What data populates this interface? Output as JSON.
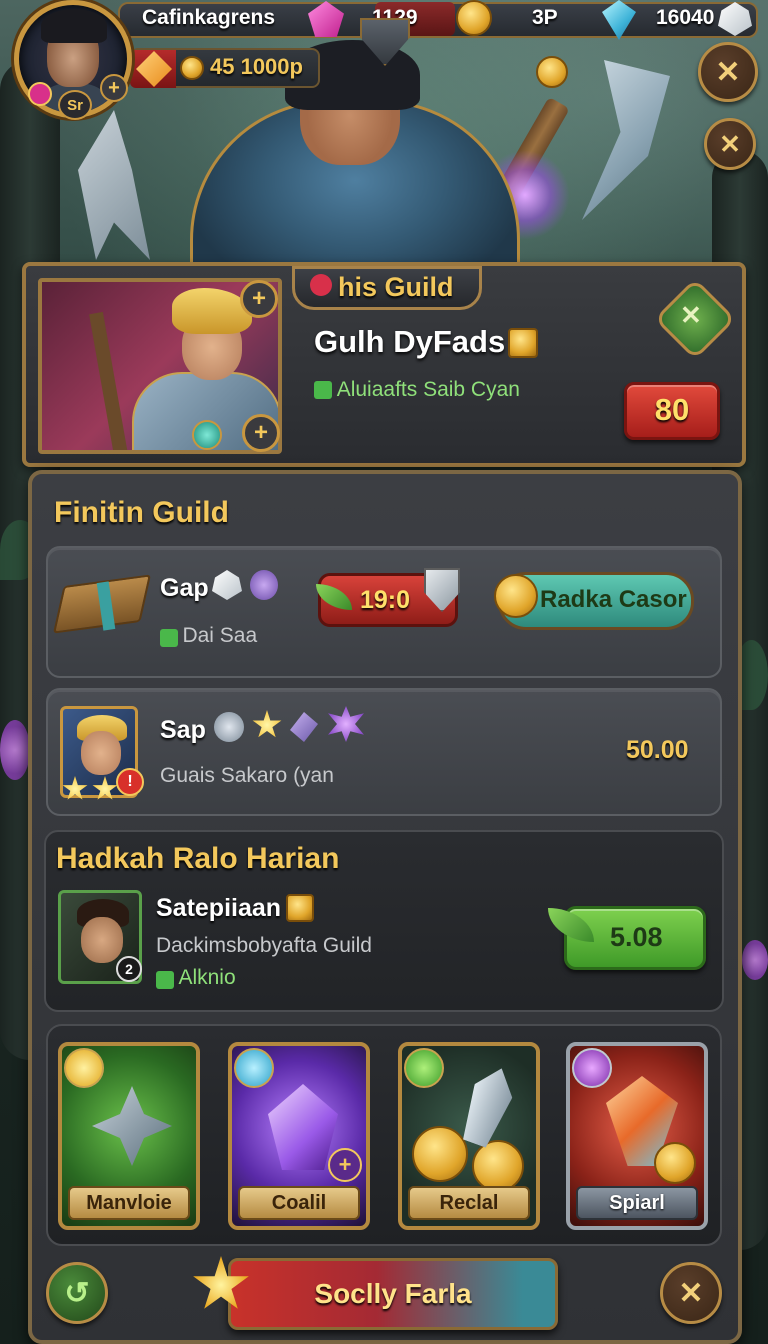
{
  "hud": {
    "player_name": "Cafinkagrens",
    "gems": "1129",
    "points": "3P",
    "crystals": "16040",
    "avatar_badge": "Sr",
    "resource_line": "45 1000p"
  },
  "banner": {
    "title": "his Guild",
    "guild_name": "Gulh DyFads",
    "status": "Aluiaafts Saib Cyan",
    "value": "80"
  },
  "panel": {
    "section_title": "Finitin Guild",
    "row1": {
      "title": "Gap",
      "sub": "Dai Saa",
      "price": "19:0",
      "button": "Radka Casor"
    },
    "row2": {
      "title": "Sap",
      "sub": "Guais Sakaro (yan",
      "amount": "50.00"
    },
    "section2_title": "Hadkah Ralo Harian",
    "row3": {
      "title": "Satepiiaan",
      "sub": "Dackimsbobyafta Guild",
      "check": "Alknio",
      "button": "5.08"
    }
  },
  "items": [
    {
      "label": "Manvloie"
    },
    {
      "label": "Coalil"
    },
    {
      "label": "Reclal"
    },
    {
      "label": "Spiarl"
    }
  ],
  "bottom": {
    "main_button": "Soclly Farla"
  },
  "colors": {
    "gold": "#f3c85c",
    "frame": "#9b7840",
    "panel": "#3c3e43",
    "accent_red": "#d8423a",
    "accent_green": "#7ed04e",
    "accent_teal": "#5ec8b2"
  },
  "icons": {
    "top_close": "close-icon",
    "secondary_close": "close-icon",
    "back": "back-arrow-icon",
    "bottom_close": "close-icon"
  }
}
